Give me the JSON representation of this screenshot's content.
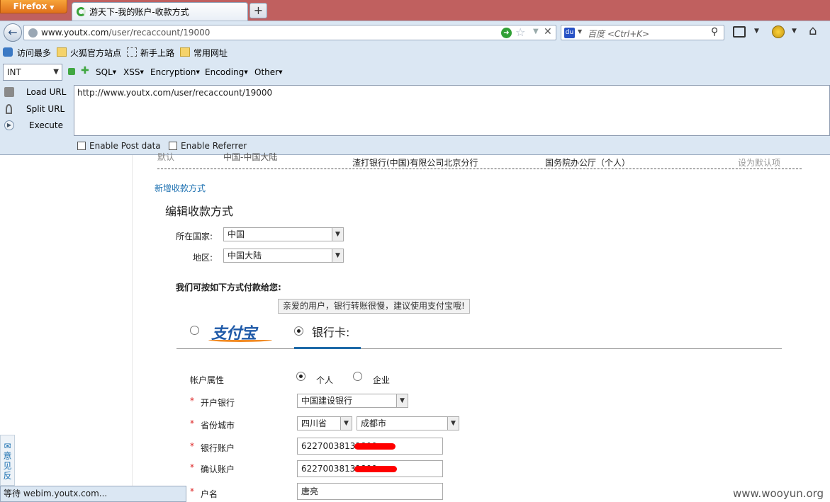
{
  "browser": {
    "app_menu": "Firefox",
    "tab_title": "游天下-我的账户-收款方式",
    "url_domain": "www.youtx.com",
    "url_path": "/user/recaccount/19000",
    "search_placeholder": "百度 <Ctrl+K>",
    "status_text": "等待 webim.youtx.com..."
  },
  "bookmarks": [
    "访问最多",
    "火狐官方站点",
    "新手上路",
    "常用网址"
  ],
  "hackbar": {
    "type_select": "INT",
    "menus": [
      "SQL",
      "XSS",
      "Encryption",
      "Encoding",
      "Other"
    ],
    "actions": [
      "Load URL",
      "Split URL",
      "Execute"
    ],
    "url_value": "http://www.youtx.com/user/recaccount/19000",
    "options": [
      "Enable Post data",
      "Enable Referrer"
    ]
  },
  "page": {
    "top_row": {
      "default_label": "默认",
      "region": "中国-中国大陆",
      "bank": "渣打银行(中国)有限公司北京分行",
      "holder": "国务院办公厅（个人）",
      "set_default": "设为默认项"
    },
    "add_method_link": "新增收款方式",
    "section_title": "编辑收款方式",
    "country_label": "所在国家:",
    "country_value": "中国",
    "region_label": "地区:",
    "region_value": "中国大陆",
    "pay_heading": "我们可按如下方式付款给您:",
    "tooltip": "亲爱的用户，银行转账很慢，建议使用支付宝哦!",
    "alipay_logo": "支付宝",
    "bank_tab": "银行卡:",
    "account_type_label": "帐户属性",
    "account_type_options": [
      "个人",
      "企业"
    ],
    "required_mark": "*",
    "bank_label": "开户银行",
    "bank_value": "中国建设银行",
    "province_city_label": "省份城市",
    "province_value": "四川省",
    "city_value": "成都市",
    "account_label": "银行账户",
    "account_value": "62270038131800",
    "confirm_label": "确认账户",
    "confirm_value": "62270038131800",
    "name_label": "户名",
    "name_value": "唐亮",
    "feedback": "意见反"
  },
  "watermark": "www.wooyun.org"
}
